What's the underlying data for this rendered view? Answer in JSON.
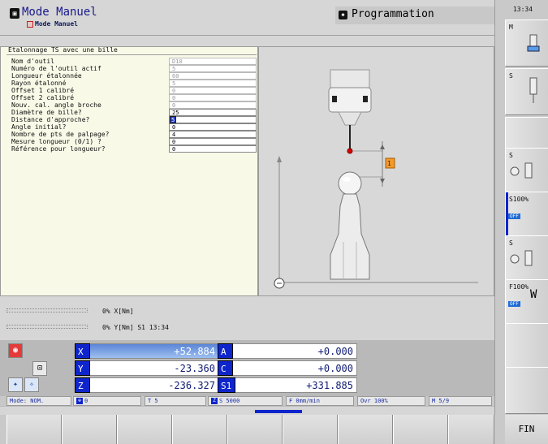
{
  "header": {
    "mode_title": "Mode Manuel",
    "mode_sub": "Mode Manuel",
    "prog_title": "Programmation",
    "clock": "13:34"
  },
  "form": {
    "title": "Etalonnage TS avec une bille",
    "params": [
      {
        "label": "Nom d'outil",
        "value": "D10"
      },
      {
        "label": "Numéro de l'outil actif",
        "value": "5"
      },
      {
        "label": "Longueur étalonnée",
        "value": "60"
      },
      {
        "label": "Rayon étalonné",
        "value": "5"
      },
      {
        "label": "Offset 1 calibré",
        "value": "0"
      },
      {
        "label": "Offset 2 calibré",
        "value": "0"
      },
      {
        "label": "Nouv. cal. angle broche",
        "value": "0"
      },
      {
        "label": "Diamètre de bille?",
        "value": "25"
      },
      {
        "label": "Distance d'approche?",
        "value": "5"
      },
      {
        "label": "Angle initial?",
        "value": "0"
      },
      {
        "label": "Nombre de pts de palpage?",
        "value": "4"
      },
      {
        "label": "Mesure longueur (0/1) ?",
        "value": "0"
      },
      {
        "label": "Référence pour longueur?",
        "value": "0"
      }
    ]
  },
  "drawing": {
    "approach_label": "1"
  },
  "status": {
    "line1": "0% X[Nm]",
    "line2": "0% Y[Nm] S1   13:34"
  },
  "positions": {
    "x": {
      "axis": "X",
      "value": "+52.884"
    },
    "y": {
      "axis": "Y",
      "value": "-23.360"
    },
    "z": {
      "axis": "Z",
      "value": "-236.327"
    },
    "a": {
      "axis": "A",
      "value": "+0.000"
    },
    "c": {
      "axis": "C",
      "value": "+0.000"
    },
    "s1": {
      "axis": "S1",
      "value": "+331.885"
    }
  },
  "info_row": {
    "mode": "Mode: NOM.",
    "datum": "0",
    "tool": "T 5",
    "spindle": "S 5000",
    "feed": "F 0mm/min",
    "override": "Ovr 100%",
    "mfunc": "M 5/9"
  },
  "right_keys": [
    {
      "label": "M"
    },
    {
      "label": "S"
    },
    {
      "label": ""
    },
    {
      "label": "S"
    },
    {
      "label": "S100%",
      "off": "OFF"
    },
    {
      "label": "S"
    },
    {
      "label": "F100%",
      "off": "OFF"
    }
  ],
  "softkeys": {
    "fin": "FIN"
  }
}
